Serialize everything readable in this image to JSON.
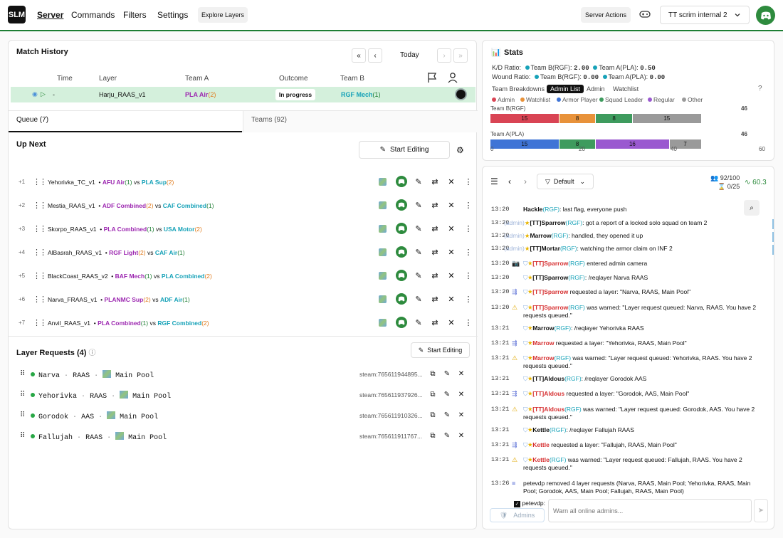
{
  "nav": {
    "logo": "SLM",
    "links": [
      "Server",
      "Commands",
      "Filters",
      "Settings"
    ],
    "explore": "Explore Layers",
    "server_actions": "Server Actions",
    "server_name": "TT scrim internal 2"
  },
  "match_history": {
    "title": "Match History",
    "today": "Today",
    "headers": [
      "Time",
      "Layer",
      "Team A",
      "Outcome",
      "Team B"
    ],
    "row": {
      "time": "-",
      "layer": "Harju_RAAS_v1",
      "team_a": "PLA Air",
      "team_a_n": "(2)",
      "outcome": "In progress",
      "team_b": "RGF Mech",
      "team_b_n": "(1)"
    }
  },
  "tabs": {
    "queue": "Queue (7)",
    "teams": "Teams (92)"
  },
  "queue": {
    "title": "Up Next",
    "start_editing": "Start Editing",
    "vs": "vs",
    "items": [
      {
        "pos": "+1",
        "layer": "Yehorivka_TC_v1",
        "a": "AFU Air",
        "an": "(1)",
        "b": "PLA Sup",
        "bn": "(2)"
      },
      {
        "pos": "+2",
        "layer": "Mestia_RAAS_v1",
        "a": "ADF Combined",
        "an": "(2)",
        "b": "CAF Combined",
        "bn": "(1)"
      },
      {
        "pos": "+3",
        "layer": "Skorpo_RAAS_v1",
        "a": "PLA Combined",
        "an": "(1)",
        "b": "USA Motor",
        "bn": "(2)"
      },
      {
        "pos": "+4",
        "layer": "AlBasrah_RAAS_v1",
        "a": "RGF Light",
        "an": "(2)",
        "b": "CAF Air",
        "bn": "(1)"
      },
      {
        "pos": "+5",
        "layer": "BlackCoast_RAAS_v2",
        "a": "BAF Mech",
        "an": "(1)",
        "b": "PLA Combined",
        "bn": "(2)"
      },
      {
        "pos": "+6",
        "layer": "Narva_FRAAS_v1",
        "a": "PLANMC Sup",
        "an": "(2)",
        "b": "ADF Air",
        "bn": "(1)"
      },
      {
        "pos": "+7",
        "layer": "Anvil_RAAS_v1",
        "a": "PLA Combined",
        "an": "(1)",
        "b": "RGF Combined",
        "bn": "(2)"
      }
    ]
  },
  "layer_requests": {
    "title": "Layer Requests (4)",
    "start_editing": "Start Editing",
    "items": [
      {
        "map": "Narva",
        "mode": "RAAS",
        "pool": "Main Pool",
        "steam": "steam:765611944895..."
      },
      {
        "map": "Yehorivka",
        "mode": "RAAS",
        "pool": "Main Pool",
        "steam": "steam:765611937926..."
      },
      {
        "map": "Gorodok",
        "mode": "AAS",
        "pool": "Main Pool",
        "steam": "steam:765611910326..."
      },
      {
        "map": "Fallujah",
        "mode": "RAAS",
        "pool": "Main Pool",
        "steam": "steam:765611911767..."
      }
    ]
  },
  "stats": {
    "title": "Stats",
    "kd_label": "K/D Ratio:",
    "kd_b_label": "Team B(RGF):",
    "kd_b": "2.00",
    "kd_a_label": "Team A(PLA):",
    "kd_a": "0.50",
    "wound_label": "Wound Ratio:",
    "wound_b_label": "Team B(RGF):",
    "wound_b": "0.00",
    "wound_a_label": "Team A(PLA):",
    "wound_a": "0.00",
    "subtabs": [
      "Team Breakdowns",
      "Admin List",
      "Admin",
      "Watchlist"
    ],
    "legend": [
      "Admin",
      "Watchlist",
      "Armor Player",
      "Squad Leader",
      "Regular",
      "Other"
    ],
    "colors": {
      "admin": "#d94454",
      "watchlist": "#e8923a",
      "armor": "#3f74d6",
      "squad": "#3e9b5e",
      "regular": "#9a59d0",
      "other": "#9a9a9a"
    }
  },
  "chart_data": {
    "type": "bar",
    "orientation": "horizontal-stacked",
    "categories": [
      "Team B(RGF)",
      "Team A(PLA)"
    ],
    "totals": [
      46,
      46
    ],
    "series": [
      {
        "name": "Admin",
        "values": [
          15,
          0
        ]
      },
      {
        "name": "Watchlist",
        "values": [
          8,
          0
        ]
      },
      {
        "name": "Armor Player",
        "values": [
          0,
          15
        ]
      },
      {
        "name": "Squad Leader",
        "values": [
          8,
          8
        ]
      },
      {
        "name": "Regular",
        "values": [
          0,
          16
        ]
      },
      {
        "name": "Other",
        "values": [
          15,
          7
        ]
      }
    ],
    "xlim": [
      0,
      60
    ],
    "xticks": [
      "0",
      "20",
      "40",
      "60"
    ]
  },
  "chat": {
    "preset": "Default",
    "players": "92/100",
    "queue": "0/25",
    "tps": "60.3",
    "placeholder": "Warn all online admins...",
    "admins_select": "Admins",
    "checkbox_label": "petevdp:",
    "lines": [
      {
        "time": "13:20",
        "pre": "",
        "name": "Hackle",
        "team": "(RGF)",
        "text": ": last flag, everyone push"
      },
      {
        "time": "13:20",
        "pre": "(admin)",
        "name": "[TT]Sparrow",
        "team": "(RGF)",
        "text": ": got a report of a locked solo squad on team 2"
      },
      {
        "time": "13:20",
        "pre": "(admin)",
        "name": "Marrow",
        "team": "(RGF)",
        "text": ": handled, they opened it up"
      },
      {
        "time": "13:20",
        "pre": "(admin)",
        "name": "[TT]Mortar",
        "team": "(RGF)",
        "text": ": watching the armor claim on INF 2"
      },
      {
        "time": "13:20",
        "pre": "",
        "name": "[TT]Sparrow",
        "team": "(RGF)",
        "text": " entered admin camera"
      },
      {
        "time": "13:20",
        "pre": "",
        "name": "[TT]Sparrow",
        "team": "(RGF)",
        "text": ": /reqlayer Narva RAAS"
      },
      {
        "time": "13:20",
        "pre": "",
        "name": "[TT]Sparrow",
        "team": "",
        "text": " requested a layer: \"Narva, RAAS, Main Pool\""
      },
      {
        "time": "13:20",
        "pre": "",
        "name": "[TT]Sparrow",
        "team": "(RGF)",
        "text": " was warned: \"Layer request queued: Narva, RAAS. You have 2 requests queued.\""
      },
      {
        "time": "13:21",
        "pre": "",
        "name": "Marrow",
        "team": "(RGF)",
        "text": ": /reqlayer Yehorivka RAAS"
      },
      {
        "time": "13:21",
        "pre": "",
        "name": "Marrow",
        "team": "",
        "text": " requested a layer: \"Yehorivka, RAAS, Main Pool\""
      },
      {
        "time": "13:21",
        "pre": "",
        "name": "Marrow",
        "team": "(RGF)",
        "text": " was warned: \"Layer request queued: Yehorivka, RAAS. You have 2 requests queued.\""
      },
      {
        "time": "13:21",
        "pre": "",
        "name": "[TT]Aldous",
        "team": "(RGF)",
        "text": ": /reqlayer Gorodok AAS"
      },
      {
        "time": "13:21",
        "pre": "",
        "name": "[TT]Aldous",
        "team": "",
        "text": " requested a layer: \"Gorodok, AAS, Main Pool\""
      },
      {
        "time": "13:21",
        "pre": "",
        "name": "[TT]Aldous",
        "team": "(RGF)",
        "text": " was warned: \"Layer request queued: Gorodok, AAS. You have 2 requests queued.\""
      },
      {
        "time": "13:21",
        "pre": "",
        "name": "Kettle",
        "team": "(RGF)",
        "text": ": /reqlayer Fallujah RAAS"
      },
      {
        "time": "13:21",
        "pre": "",
        "name": "Kettle",
        "team": "",
        "text": " requested a layer: \"Fallujah, RAAS, Main Pool\""
      },
      {
        "time": "13:21",
        "pre": "",
        "name": "Kettle",
        "team": "(RGF)",
        "text": " was warned: \"Layer request queued: Fallujah, RAAS. You have 2 requests queued.\""
      },
      {
        "time": "13:26",
        "pre": "",
        "name": "",
        "team": "",
        "text": "petevdp removed 4 layer requests (Narva, RAAS, Main Pool; Yehorivka, RAAS, Main Pool; Gorodok, AAS, Main Pool; Fallujah, RAAS, Main Pool)"
      }
    ]
  }
}
